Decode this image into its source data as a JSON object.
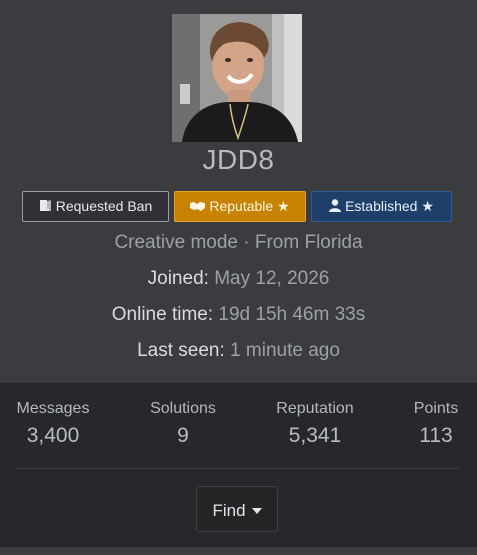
{
  "profile": {
    "username": "JDD8",
    "avatar_alt": "avatar",
    "banners": [
      {
        "label": "Requested Ban",
        "icon": "door-exit-icon",
        "color": "#2f3134"
      },
      {
        "label": "Reputable ★",
        "icon": "handshake-icon",
        "color": "#c78300"
      },
      {
        "label": "Established ★",
        "icon": "user-icon",
        "color": "#1e3f6a"
      }
    ],
    "blurb": "Creative mode · From Florida",
    "joined": {
      "label": "Joined:",
      "value": "May 12, 2026"
    },
    "online": {
      "label": "Online time:",
      "value": "19d 15h 46m 33s"
    },
    "last_seen": {
      "label": "Last seen:",
      "value": "1 minute ago"
    }
  },
  "stats": [
    {
      "label": "Messages",
      "value": "3,400"
    },
    {
      "label": "Solutions",
      "value": "9"
    },
    {
      "label": "Reputation",
      "value": "5,341"
    },
    {
      "label": "Points",
      "value": "113"
    }
  ],
  "find_button": {
    "label": "Find",
    "icon": "caret-down-icon"
  },
  "colors": {
    "header_bg": "#3a3c40",
    "body_bg": "#26282b",
    "reputable": "#c78300",
    "established": "#1e3f6a"
  }
}
